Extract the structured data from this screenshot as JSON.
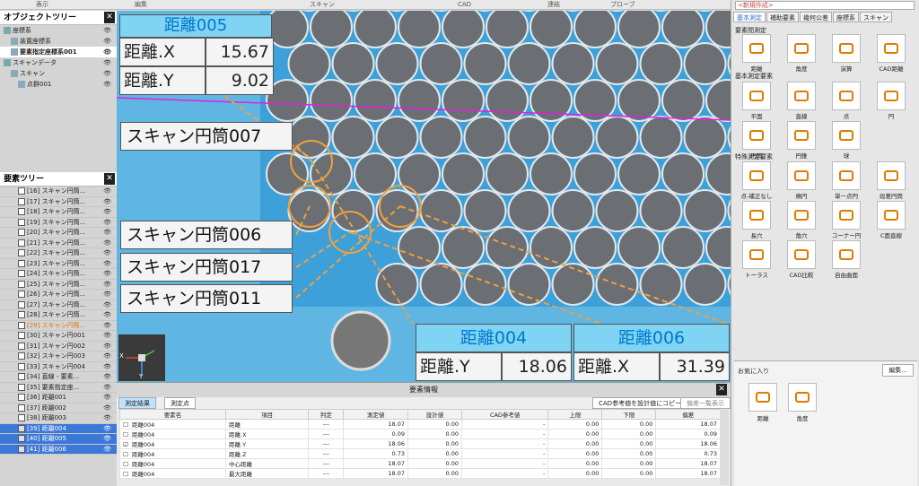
{
  "menu": [
    "表示",
    "編集",
    "スキャン",
    "CAD",
    "連結",
    "プローブ"
  ],
  "object_tree": {
    "title": "オブジェクトツリー",
    "close": "✕",
    "items": [
      {
        "label": "座標系",
        "indent": 0,
        "selected": false
      },
      {
        "label": "装置座標系",
        "indent": 1,
        "selected": false
      },
      {
        "label": "要素指定座標系001",
        "indent": 1,
        "selected": true
      },
      {
        "label": "スキャンデータ",
        "indent": 0,
        "selected": false
      },
      {
        "label": "スキャン",
        "indent": 1,
        "selected": false
      },
      {
        "label": "点群001",
        "indent": 2,
        "selected": false
      }
    ]
  },
  "element_tree": {
    "title": "要素ツリー",
    "close": "✕",
    "items": [
      {
        "label": "[16] スキャン円筒...",
        "state": ""
      },
      {
        "label": "[17] スキャン円筒...",
        "state": ""
      },
      {
        "label": "[18] スキャン円筒...",
        "state": ""
      },
      {
        "label": "[19] スキャン円筒...",
        "state": ""
      },
      {
        "label": "[20] スキャン円筒...",
        "state": ""
      },
      {
        "label": "[21] スキャン円筒...",
        "state": ""
      },
      {
        "label": "[22] スキャン円筒...",
        "state": ""
      },
      {
        "label": "[23] スキャン円筒...",
        "state": ""
      },
      {
        "label": "[24] スキャン円筒...",
        "state": ""
      },
      {
        "label": "[25] スキャン円筒...",
        "state": ""
      },
      {
        "label": "[26] スキャン円筒...",
        "state": ""
      },
      {
        "label": "[27] スキャン円筒...",
        "state": ""
      },
      {
        "label": "[28] スキャン円筒...",
        "state": ""
      },
      {
        "label": "[29] スキャン円筒...",
        "state": "hl"
      },
      {
        "label": "[30] スキャン円001",
        "state": ""
      },
      {
        "label": "[31] スキャン円002",
        "state": ""
      },
      {
        "label": "[32] スキャン円003",
        "state": ""
      },
      {
        "label": "[33] スキャン円004",
        "state": ""
      },
      {
        "label": "[34] 直線 - 要素...",
        "state": ""
      },
      {
        "label": "[35] 要素指定座...",
        "state": ""
      },
      {
        "label": "[36] 距離001",
        "state": ""
      },
      {
        "label": "[37] 距離002",
        "state": ""
      },
      {
        "label": "[38] 距離003",
        "state": ""
      },
      {
        "label": "[39] 距離004",
        "state": "sel"
      },
      {
        "label": "[40] 距離005",
        "state": "sel"
      },
      {
        "label": "[41] 距離006",
        "state": "sel"
      }
    ]
  },
  "viewport": {
    "measure_005": {
      "title": "距離005",
      "x_label": "距離.X",
      "x_value": "15.67",
      "y_label": "距離.Y",
      "y_value": "9.02"
    },
    "cyl007": "スキャン円筒007",
    "cyl006": "スキャン円筒006",
    "cyl017": "スキャン円筒017",
    "cyl011": "スキャン円筒011",
    "measure_004": {
      "title": "距離004",
      "label": "距離.Y",
      "value": "18.06"
    },
    "measure_006": {
      "title": "距離006",
      "label": "距離.X",
      "value": "31.39"
    },
    "axis_x": "X",
    "axis_y": "Y"
  },
  "element_info": {
    "title": "要素情報",
    "close": "✕",
    "tabs": [
      "測定結果",
      "測定点"
    ],
    "btn_cad": "CAD参考値を設計値にコピー",
    "btn_tol": "偏差一覧表示",
    "columns": [
      "要素名",
      "項目",
      "判定",
      "測定値",
      "設計値",
      "CAD参考値",
      "上限",
      "下限",
      "偏差"
    ],
    "rows": [
      {
        "checked": false,
        "name": "距離004",
        "item": "距離",
        "judge": "---",
        "meas": "18.07",
        "design": "0.00",
        "cad": "-",
        "upper": "0.00",
        "lower": "0.00",
        "dev": "18.07"
      },
      {
        "checked": false,
        "name": "距離004",
        "item": "距離.X",
        "judge": "---",
        "meas": "0.09",
        "design": "0.00",
        "cad": "-",
        "upper": "0.00",
        "lower": "0.00",
        "dev": "0.09"
      },
      {
        "checked": true,
        "name": "距離004",
        "item": "距離.Y",
        "judge": "---",
        "meas": "18.06",
        "design": "0.00",
        "cad": "-",
        "upper": "0.00",
        "lower": "0.00",
        "dev": "18.06"
      },
      {
        "checked": false,
        "name": "距離004",
        "item": "距離.Z",
        "judge": "---",
        "meas": "0.73",
        "design": "0.00",
        "cad": "-",
        "upper": "0.00",
        "lower": "0.00",
        "dev": "0.73"
      },
      {
        "checked": false,
        "name": "距離004",
        "item": "中心距離",
        "judge": "---",
        "meas": "18.07",
        "design": "0.00",
        "cad": "-",
        "upper": "0.00",
        "lower": "0.00",
        "dev": "18.07"
      },
      {
        "checked": false,
        "name": "距離004",
        "item": "最大距離",
        "judge": "---",
        "meas": "18.07",
        "design": "0.00",
        "cad": "-",
        "upper": "0.00",
        "lower": "0.00",
        "dev": "18.07"
      }
    ]
  },
  "right_panel": {
    "new_create": "<新規作成>",
    "tabs": [
      "基本測定",
      "補助要素",
      "幾何公差",
      "座標系",
      "スキャン"
    ],
    "sections": [
      "要素間測定",
      "基本測定要素",
      "特殊測定要素"
    ],
    "tools_between": [
      "距離",
      "角度",
      "演算",
      "CAD距離"
    ],
    "tools_basic": [
      "平面",
      "直線",
      "点",
      "円",
      "円筒",
      "円錐",
      "球"
    ],
    "tools_special": [
      "点-補正なし",
      "楕円",
      "単一点円",
      "段差円筒",
      "長穴",
      "角穴",
      "コーナー円",
      "C面直線",
      "トーラス",
      "CAD比較",
      "自由曲面"
    ],
    "favorites": "お気に入り",
    "edit_btn": "編集...",
    "fav_tools": [
      "距離",
      "角度"
    ]
  },
  "colors": {
    "accent": "#3c78d8",
    "viewport_bg": "#5fb6e3",
    "hole": "#6b6e73",
    "title_text": "#0077cc",
    "dashed": "#f0a040",
    "magenta": "#e020e0"
  }
}
